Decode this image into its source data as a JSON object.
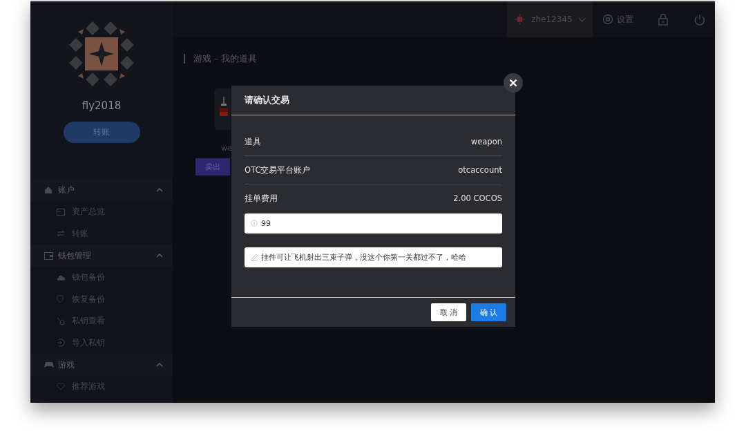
{
  "topbar": {
    "user": "zhe12345",
    "settings": "设置"
  },
  "sidebar": {
    "username": "fly2018",
    "transfer_button": "转账",
    "menu": [
      {
        "label": "账户",
        "expanded": true,
        "children": [
          {
            "label": "资产总览"
          },
          {
            "label": "转账"
          }
        ]
      },
      {
        "label": "钱包管理",
        "expanded": true,
        "children": [
          {
            "label": "钱包备份"
          },
          {
            "label": "恢复备份"
          },
          {
            "label": "私钥查看"
          },
          {
            "label": "导入私钥"
          }
        ]
      },
      {
        "label": "游戏",
        "expanded": true,
        "children": [
          {
            "label": "推荐游戏"
          }
        ]
      }
    ]
  },
  "breadcrumb": "游戏 – 我的道具",
  "item_card": {
    "name": "we",
    "sell_button": "卖出"
  },
  "dialog": {
    "title": "请确认交易",
    "rows": [
      {
        "label": "道具",
        "value": "weapon"
      },
      {
        "label": "OTC交易平台账户",
        "value": "otcaccount"
      },
      {
        "label": "挂单费用",
        "value": "2.00 COCOS"
      }
    ],
    "price_field": {
      "value": "99"
    },
    "note_field": {
      "value": "挂件可让飞机射出三束子弹，没这个你第一关都过不了，哈哈"
    },
    "buttons": {
      "cancel": "取 消",
      "confirm": "确 认"
    }
  }
}
